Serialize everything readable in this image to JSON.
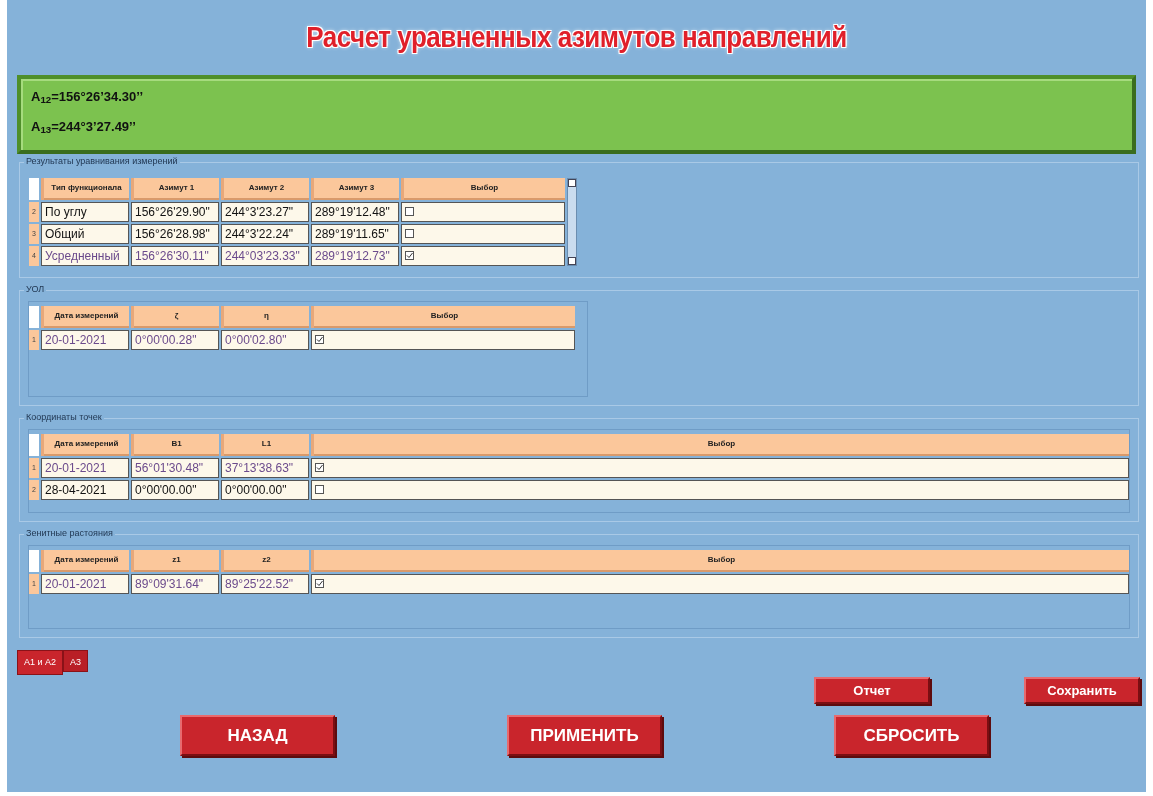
{
  "title": "Расчет уравненных азимутов направлений",
  "results": [
    "A$_{12}$=156°26’34.30’’",
    "A$_{13}$=244°3’27.49’’"
  ],
  "sections": [
    {
      "title": "Результаты уравнивания измерений",
      "scrollbar": true,
      "columns": [
        "Тип функционала",
        "Азимут 1",
        "Азимут 2",
        "Азимут 3",
        "Выбор"
      ],
      "rows": [
        {
          "number": "2",
          "cells": [
            "По углу",
            "156°26'29.90\"",
            "244°3'23.27\"",
            "289°19'12.48\""
          ],
          "checked": false
        },
        {
          "number": "3",
          "cells": [
            "Общий",
            "156°26'28.98\"",
            "244°3'22.24\"",
            "289°19'11.65\""
          ],
          "checked": false
        },
        {
          "number": "4",
          "cells": [
            "Усредненный",
            "156°26'30.11\"",
            "244°03'23.33\"",
            "289°19'12.73\""
          ],
          "checked": true
        }
      ]
    },
    {
      "title": "УОЛ",
      "scrollbar": false,
      "columns": [
        "Дата измерений",
        "ζ",
        "η",
        "Выбор"
      ],
      "rows": [
        {
          "number": "1",
          "cells": [
            "20-01-2021",
            "0°00'00.28\"",
            "0°00'02.80\""
          ],
          "checked": true
        }
      ]
    },
    {
      "title": "Координаты точек",
      "scrollbar": false,
      "columns": [
        "Дата измерений",
        "B1",
        "L1",
        "Выбор"
      ],
      "rows": [
        {
          "number": "1",
          "cells": [
            "20-01-2021",
            "56°01'30.48\"",
            "37°13'38.63\""
          ],
          "checked": true
        },
        {
          "number": "2",
          "cells": [
            "28-04-2021",
            "0°00'00.00\"",
            "0°00'00.00\""
          ],
          "checked": false
        }
      ]
    },
    {
      "title": "Зенитные растояния",
      "scrollbar": false,
      "columns": [
        "Дата измерений",
        "z1",
        "z2",
        "Выбор"
      ],
      "rows": [
        {
          "number": "1",
          "cells": [
            "20-01-2021",
            "89°09'31.64\"",
            "89°25'22.52\""
          ],
          "checked": true
        }
      ]
    }
  ],
  "tabs": [
    {
      "label": "A1 и A2",
      "selected": true
    },
    {
      "label": "A3",
      "selected": false
    }
  ],
  "small_buttons": [
    "Отчет",
    "Сохранить"
  ],
  "buttons": [
    "НАЗАД",
    "ПРИМЕНИТЬ",
    "СБРОСИТЬ"
  ]
}
